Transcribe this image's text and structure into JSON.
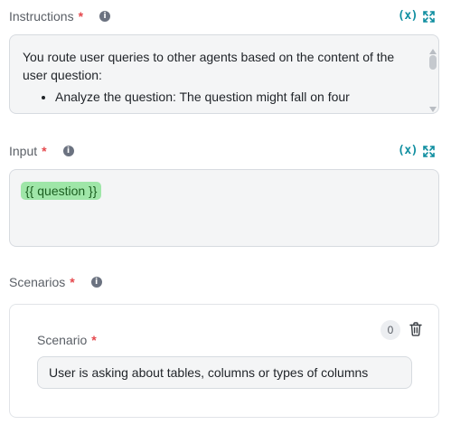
{
  "instructions": {
    "label": "Instructions",
    "required_mark": "*",
    "info_glyph": "i",
    "variables_label": "(x)",
    "text_line1": "You route user queries to other agents based on the content of the user question:",
    "bullet1": "Analyze the question: The question might fall on four"
  },
  "input": {
    "label": "Input",
    "required_mark": "*",
    "info_glyph": "i",
    "variables_label": "(x)",
    "chip": "{{ question }}"
  },
  "scenarios": {
    "label": "Scenarios",
    "required_mark": "*",
    "info_glyph": "i",
    "items": [
      {
        "label": "Scenario",
        "required_mark": "*",
        "count": "0",
        "value": "User is asking about tables, columns or types of columns"
      }
    ]
  },
  "colors": {
    "accent": "#0f8ea0",
    "required": "#e5484d",
    "chip_bg": "#9fe6a8",
    "field_bg": "#f4f5f6"
  }
}
